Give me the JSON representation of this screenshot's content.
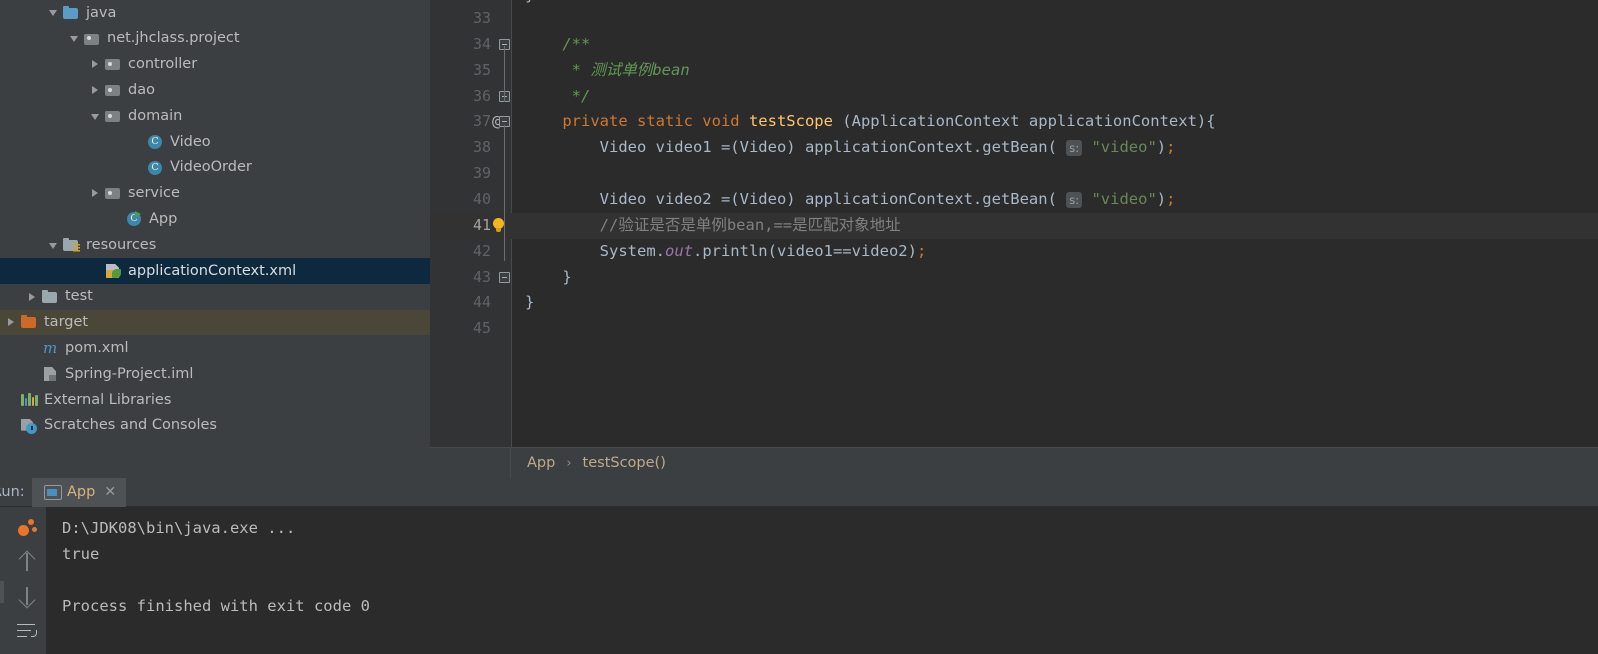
{
  "project_tree": {
    "items": [
      {
        "label": "java",
        "indent": 47,
        "twisty": "expanded",
        "icon": "folder-source-icon",
        "state": "normal"
      },
      {
        "label": "net.jhclass.project",
        "indent": 68,
        "twisty": "expanded",
        "icon": "folder-package-icon",
        "state": "normal"
      },
      {
        "label": "controller",
        "indent": 89,
        "twisty": "collapsed",
        "icon": "folder-package-icon",
        "state": "normal"
      },
      {
        "label": "dao",
        "indent": 89,
        "twisty": "collapsed",
        "icon": "folder-package-icon",
        "state": "normal"
      },
      {
        "label": "domain",
        "indent": 89,
        "twisty": "expanded",
        "icon": "folder-package-icon",
        "state": "normal"
      },
      {
        "label": "Video",
        "indent": 131,
        "twisty": "none",
        "icon": "java-class-icon",
        "state": "normal"
      },
      {
        "label": "VideoOrder",
        "indent": 131,
        "twisty": "none",
        "icon": "java-class-icon",
        "state": "normal"
      },
      {
        "label": "service",
        "indent": 89,
        "twisty": "collapsed",
        "icon": "folder-package-icon",
        "state": "normal"
      },
      {
        "label": "App",
        "indent": 110,
        "twisty": "none",
        "icon": "java-class-runnable-icon",
        "state": "normal"
      },
      {
        "label": "resources",
        "indent": 47,
        "twisty": "expanded",
        "icon": "folder-resources-icon",
        "state": "normal"
      },
      {
        "label": "applicationContext.xml",
        "indent": 89,
        "twisty": "none",
        "icon": "xml-spring-file-icon",
        "state": "selected"
      },
      {
        "label": "test",
        "indent": 26,
        "twisty": "collapsed",
        "icon": "folder-test-icon",
        "state": "normal"
      },
      {
        "label": "target",
        "indent": 5,
        "twisty": "collapsed",
        "icon": "folder-excluded-icon",
        "state": "excluded"
      },
      {
        "label": "pom.xml",
        "indent": 26,
        "twisty": "none",
        "icon": "maven-file-icon",
        "state": "normal"
      },
      {
        "label": "Spring-Project.iml",
        "indent": 26,
        "twisty": "none",
        "icon": "iml-file-icon",
        "state": "normal"
      },
      {
        "label": "External Libraries",
        "indent": 5,
        "twisty": "none",
        "icon": "libraries-icon",
        "state": "normal"
      },
      {
        "label": "Scratches and Consoles",
        "indent": 5,
        "twisty": "none",
        "icon": "scratches-icon",
        "state": "normal"
      }
    ]
  },
  "editor": {
    "top_fragment": "}",
    "lines": [
      {
        "num": "33",
        "current": false,
        "gutter": "none",
        "tokens": []
      },
      {
        "num": "34",
        "current": false,
        "gutter": "fold-start",
        "tokens": [
          {
            "t": "    ",
            "c": ""
          },
          {
            "t": "/**",
            "c": "doc"
          }
        ]
      },
      {
        "num": "35",
        "current": false,
        "gutter": "fold-mid",
        "tokens": [
          {
            "t": "     ",
            "c": ""
          },
          {
            "t": "* 测试单例bean",
            "c": "doc"
          }
        ]
      },
      {
        "num": "36",
        "current": false,
        "gutter": "fold-end",
        "tokens": [
          {
            "t": "     ",
            "c": ""
          },
          {
            "t": "*/",
            "c": "doc"
          }
        ]
      },
      {
        "num": "37",
        "current": false,
        "gutter": "fold-start",
        "annotation": "@",
        "tokens": [
          {
            "t": "    ",
            "c": ""
          },
          {
            "t": "private static void ",
            "c": "kw"
          },
          {
            "t": "testScope ",
            "c": "mth"
          },
          {
            "t": "(ApplicationContext applicationContext){",
            "c": ""
          }
        ]
      },
      {
        "num": "38",
        "current": false,
        "gutter": "none",
        "tokens": [
          {
            "t": "        Video video1 =(Video) applicationContext.getBean( ",
            "c": ""
          },
          {
            "t": "s:",
            "c": "hint"
          },
          {
            "t": " ",
            "c": ""
          },
          {
            "t": "\"video\"",
            "c": "str"
          },
          {
            "t": ")",
            "c": ""
          },
          {
            "t": ";",
            "c": "kw"
          }
        ]
      },
      {
        "num": "39",
        "current": false,
        "gutter": "none",
        "tokens": []
      },
      {
        "num": "40",
        "current": false,
        "gutter": "none",
        "tokens": [
          {
            "t": "        Video video2 =(Video) applicationContext.getBean( ",
            "c": ""
          },
          {
            "t": "s:",
            "c": "hint"
          },
          {
            "t": " ",
            "c": ""
          },
          {
            "t": "\"video\"",
            "c": "str"
          },
          {
            "t": ")",
            "c": ""
          },
          {
            "t": ";",
            "c": "kw"
          }
        ]
      },
      {
        "num": "41",
        "current": true,
        "gutter": "bulb",
        "tokens": [
          {
            "t": "        //验证是否是单例bean,==是匹配对象地址",
            "c": "cmt"
          }
        ]
      },
      {
        "num": "42",
        "current": false,
        "gutter": "none",
        "tokens": [
          {
            "t": "        System.",
            "c": ""
          },
          {
            "t": "out",
            "c": "fld"
          },
          {
            "t": ".println(video1==video2)",
            "c": ""
          },
          {
            "t": ";",
            "c": "kw"
          }
        ]
      },
      {
        "num": "43",
        "current": false,
        "gutter": "fold-end",
        "tokens": [
          {
            "t": "    }",
            "c": ""
          }
        ]
      },
      {
        "num": "44",
        "current": false,
        "gutter": "none",
        "tokens": [
          {
            "t": "}",
            "c": ""
          }
        ]
      },
      {
        "num": "45",
        "current": false,
        "gutter": "none",
        "tokens": []
      }
    ],
    "breadcrumb": {
      "class": "App",
      "separator": "›",
      "method": "testScope()"
    }
  },
  "run_panel": {
    "title": "Run:",
    "tab": {
      "label": "App",
      "close": "✕"
    },
    "toolbar": [
      {
        "name": "rerun-icon"
      },
      {
        "name": "scroll-up-icon"
      },
      {
        "name": "scroll-down-icon"
      },
      {
        "name": "soft-wrap-icon"
      }
    ],
    "console": {
      "command": "D:\\JDK08\\bin\\java.exe ...",
      "output": [
        "true",
        "",
        "Process finished with exit code 0"
      ]
    }
  },
  "colors": {
    "panel_bg": "#3c3f41",
    "editor_bg": "#2b2b2b",
    "gutter_bg": "#313335",
    "selection_bg": "#0d293e",
    "excluded_bg": "#4a4738",
    "keyword": "#cc7832",
    "method": "#ffc66d",
    "string": "#6a8759",
    "doc_comment": "#629755",
    "comment": "#808080",
    "field": "#9876aa",
    "text": "#a9b7c6",
    "accent_orange": "#e8752a",
    "tab_text": "#d4b483"
  }
}
